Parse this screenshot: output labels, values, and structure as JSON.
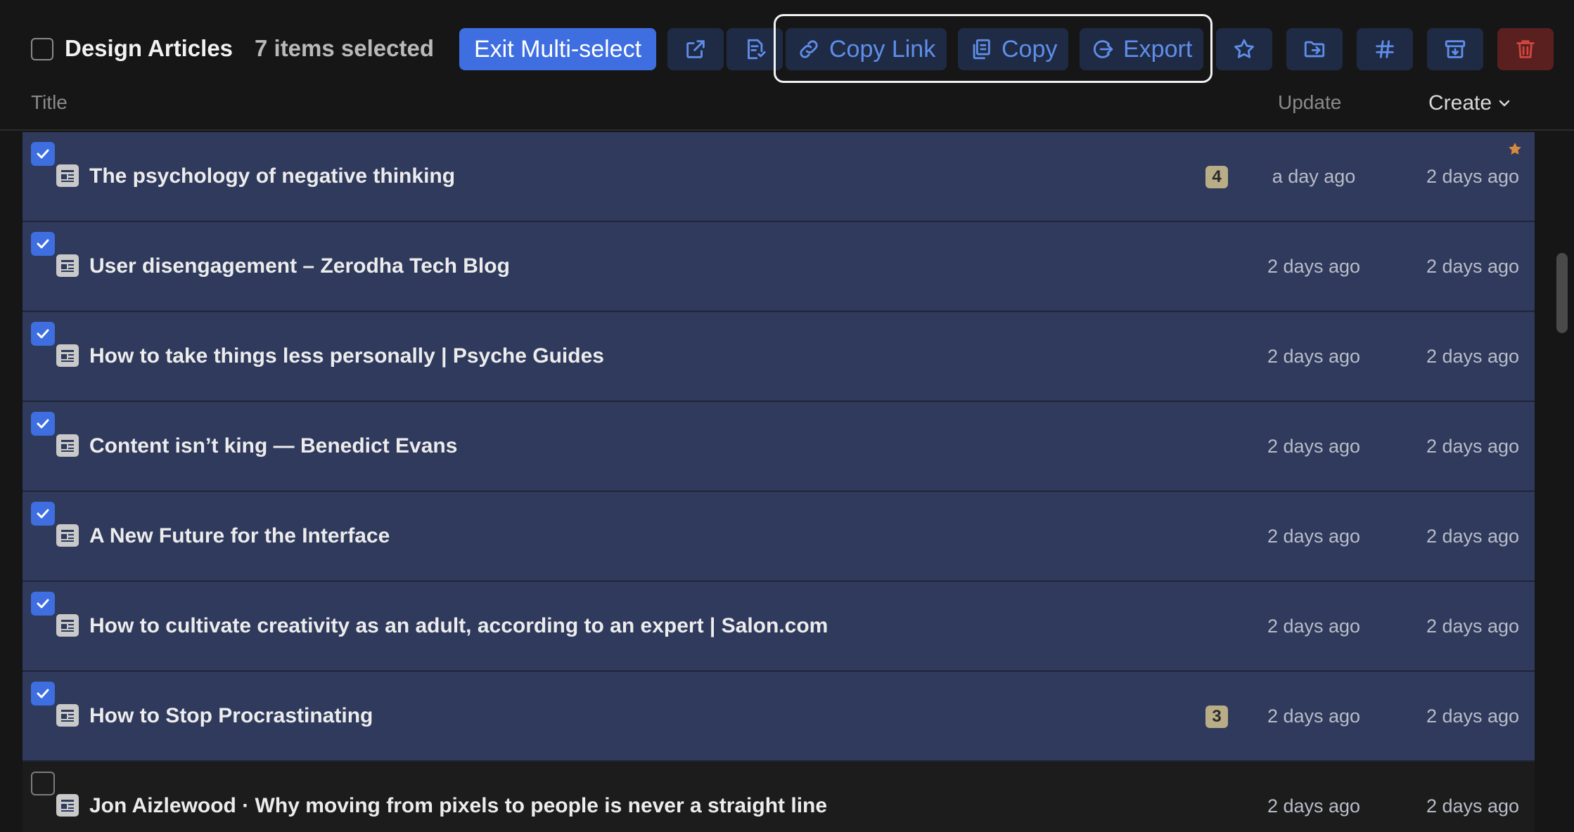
{
  "toolbar": {
    "folder_title": "Design Articles",
    "selection_count": "7 items selected",
    "exit_label": "Exit Multi-select",
    "copy_link_label": "Copy Link",
    "copy_label": "Copy",
    "export_label": "Export",
    "icons": [
      "open-external-icon",
      "summary-icon",
      "link-icon",
      "copy-icon",
      "export-icon",
      "star-icon",
      "move-folder-icon",
      "tag-hash-icon",
      "archive-icon",
      "trash-icon"
    ],
    "accent_color": "#3e6ee0",
    "danger_color": "#5a1f1f"
  },
  "columns": {
    "title": "Title",
    "update": "Update",
    "create": "Create"
  },
  "rows": [
    {
      "title": "The psychology of negative thinking",
      "badge": "4",
      "updated": "a day ago",
      "created": "2 days ago",
      "selected": true,
      "starred": true
    },
    {
      "title": "User disengagement – Zerodha Tech Blog",
      "badge": "",
      "updated": "2 days ago",
      "created": "2 days ago",
      "selected": true,
      "starred": false
    },
    {
      "title": "How to take things less personally | Psyche Guides",
      "badge": "",
      "updated": "2 days ago",
      "created": "2 days ago",
      "selected": true,
      "starred": false
    },
    {
      "title": "Content isn’t king — Benedict Evans",
      "badge": "",
      "updated": "2 days ago",
      "created": "2 days ago",
      "selected": true,
      "starred": false
    },
    {
      "title": "A New Future for the Interface",
      "badge": "",
      "updated": "2 days ago",
      "created": "2 days ago",
      "selected": true,
      "starred": false
    },
    {
      "title": "How to cultivate creativity as an adult, according to an expert | Salon.com",
      "badge": "",
      "updated": "2 days ago",
      "created": "2 days ago",
      "selected": true,
      "starred": false
    },
    {
      "title": "How to Stop Procrastinating",
      "badge": "3",
      "updated": "2 days ago",
      "created": "2 days ago",
      "selected": true,
      "starred": false
    },
    {
      "title": "Jon Aizlewood · Why moving from pixels to people is never a straight line",
      "badge": "",
      "updated": "2 days ago",
      "created": "2 days ago",
      "selected": false,
      "starred": false
    }
  ]
}
